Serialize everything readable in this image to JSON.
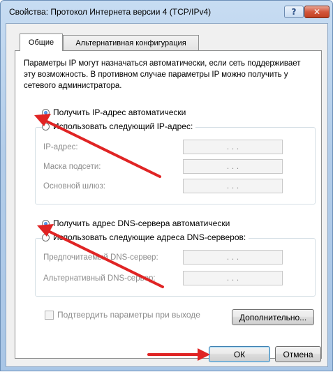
{
  "window": {
    "title": "Свойства: Протокол Интернета версии 4 (TCP/IPv4)",
    "help_label": "?",
    "close_label": "✕"
  },
  "tabs": {
    "general": "Общие",
    "alternate": "Альтернативная конфигурация"
  },
  "info_text": "Параметры IP могут назначаться автоматически, если сеть поддерживает эту возможность. В противном случае параметры IP можно получить у сетевого администратора.",
  "ip": {
    "auto_label": "Получить IP-адрес автоматически",
    "manual_label": "Использовать следующий IP-адрес:",
    "selected": "auto",
    "fields": [
      {
        "label": "IP-адрес:",
        "value": ".   .   ."
      },
      {
        "label": "Маска подсети:",
        "value": ".   .   ."
      },
      {
        "label": "Основной шлюз:",
        "value": ".   .   ."
      }
    ]
  },
  "dns": {
    "auto_label": "Получить адрес DNS-сервера автоматически",
    "manual_label": "Использовать следующие адреса DNS-серверов:",
    "selected": "auto",
    "fields": [
      {
        "label": "Предпочитаемый DNS-сервер:",
        "value": ".   .   ."
      },
      {
        "label": "Альтернативный DNS-сервер:",
        "value": ".   .   ."
      }
    ]
  },
  "validate_label": "Подтвердить параметры при выходе",
  "buttons": {
    "advanced": "Дополнительно...",
    "ok": "ОК",
    "cancel": "Отмена"
  },
  "colors": {
    "arrow": "#e02424"
  }
}
